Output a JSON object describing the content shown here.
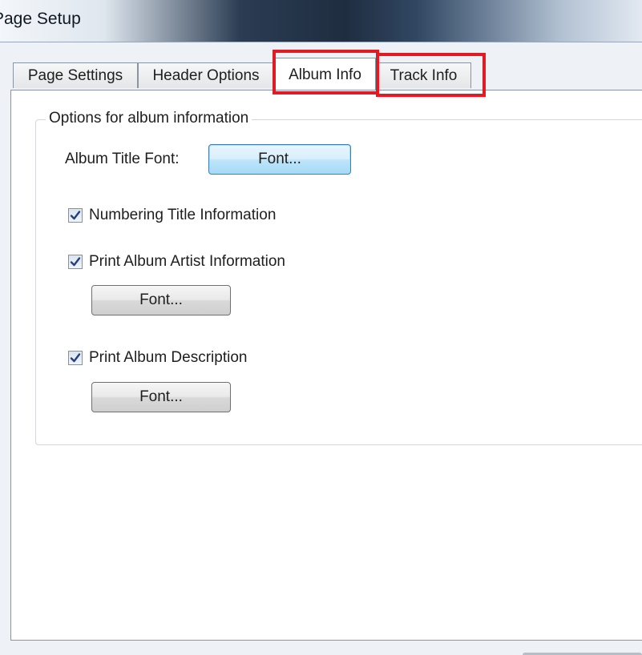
{
  "window": {
    "title": "Page Setup"
  },
  "tabs": [
    {
      "label": "Page Settings"
    },
    {
      "label": "Header Options"
    },
    {
      "label": "Album Info"
    },
    {
      "label": "Track Info"
    }
  ],
  "group": {
    "label": "Options for album information",
    "album_title_font_label": "Album Title Font:",
    "album_title_font_button": "Font...",
    "numbering_title": {
      "label": "Numbering Title Information",
      "checked": true
    },
    "print_album_artist": {
      "label": "Print Album Artist Information",
      "checked": true,
      "font_button": "Font..."
    },
    "print_album_description": {
      "label": "Print Album Description",
      "checked": true,
      "font_button": "Font..."
    }
  },
  "annotations": {
    "highlight_color": "#e01b24",
    "highlighted_tabs": [
      "Album Info",
      "Track Info"
    ]
  }
}
